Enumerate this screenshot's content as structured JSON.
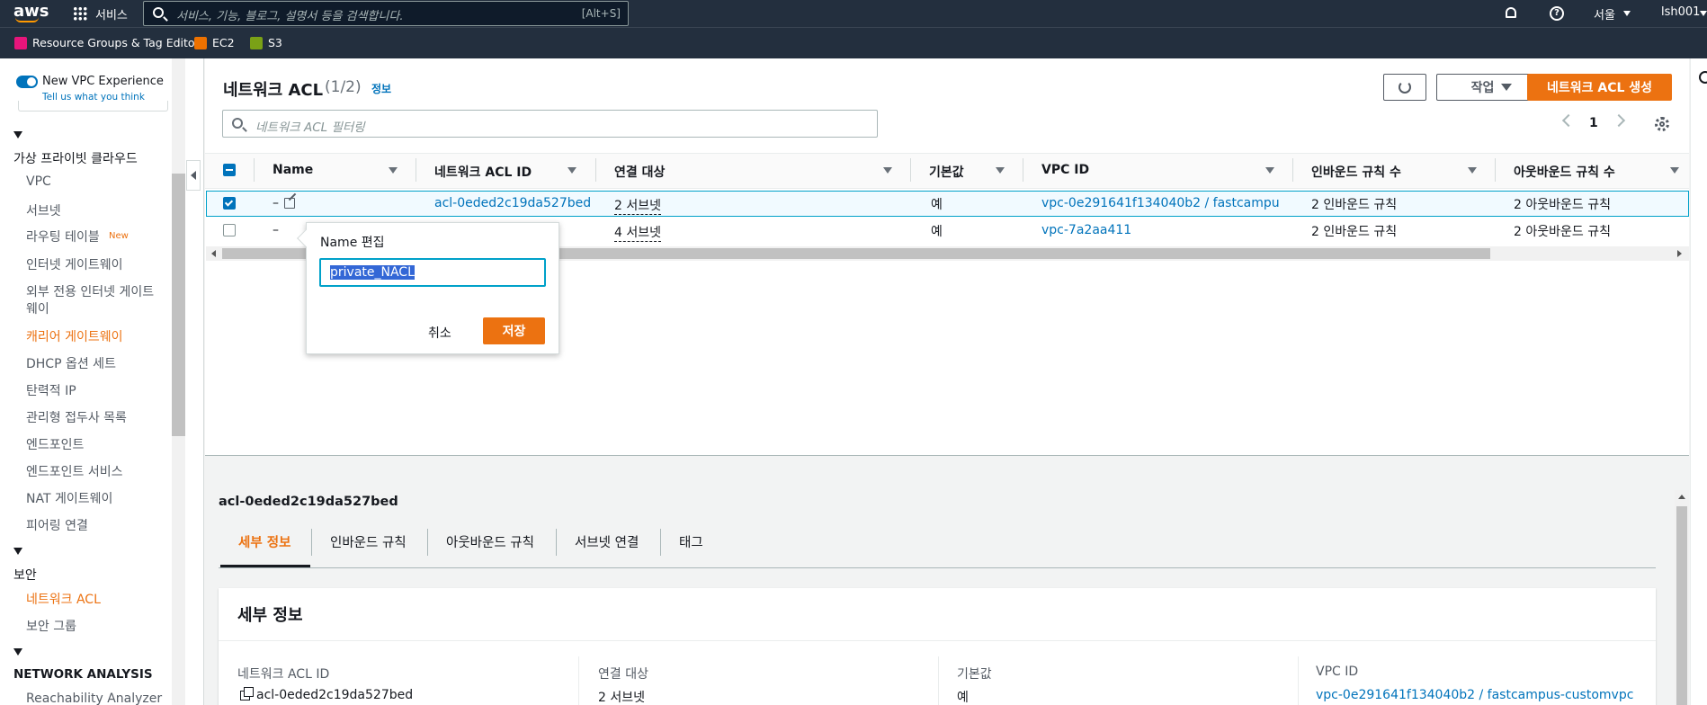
{
  "topnav": {
    "logo": "aws",
    "services_label": "서비스",
    "search_placeholder": "서비스, 기능, 블로그, 설명서 등을 검색합니다.",
    "search_shortcut": "[Alt+S]",
    "region": "서울",
    "account": "lsh001"
  },
  "favorites": [
    {
      "label": "Resource Groups & Tag Editor",
      "color": "#e7157b"
    },
    {
      "label": "EC2",
      "color": "#ed7100"
    },
    {
      "label": "S3",
      "color": "#7aa116"
    }
  ],
  "sidebar": {
    "toggle_label": "New VPC Experience",
    "toggle_sub": "Tell us what you think",
    "section1": "가상 프라이빗 클라우드",
    "items": [
      "VPC",
      "서브넷",
      "라우팅 테이블",
      "인터넷 게이트웨이",
      "외부 전용 인터넷 게이트",
      "웨이",
      "캐리어 게이트웨이",
      "DHCP 옵션 세트",
      "탄력적 IP",
      "관리형 접두사 목록",
      "엔드포인트",
      "엔드포인트 서비스",
      "NAT 게이트웨이",
      "피어링 연결"
    ],
    "new_badge": "New",
    "section2": "보안",
    "security_items": [
      "네트워크 ACL",
      "보안 그룹"
    ],
    "section3": "NETWORK ANALYSIS",
    "analysis_items": [
      "Reachability Analyzer"
    ]
  },
  "header": {
    "title": "네트워크 ACL",
    "count": "(1/2)",
    "info": "정보",
    "actions_label": "작업",
    "create_label": "네트워크 ACL 생성",
    "filter_placeholder": "네트워크 ACL 필터링",
    "page": "1"
  },
  "table": {
    "columns": [
      "Name",
      "네트워크 ACL ID",
      "연결 대상",
      "기본값",
      "VPC ID",
      "인바운드 규칙 수",
      "아웃바운드 규칙 수"
    ],
    "rows": [
      {
        "name": "–",
        "acl_id": "acl-0eded2c19da527bed",
        "assoc": "2 서브넷",
        "default": "예",
        "vpc": "vpc-0e291641f134040b2 / fastcampu…",
        "inbound": "2 인바운드 규칙",
        "outbound": "2 아웃바운드 규칙",
        "selected": true
      },
      {
        "name": "–",
        "acl_id": "",
        "assoc": "4 서브넷",
        "default": "예",
        "vpc": "vpc-7a2aa411",
        "inbound": "2 인바운드 규칙",
        "outbound": "2 아웃바운드 규칙",
        "selected": false
      }
    ]
  },
  "popover": {
    "title": "Name 편집",
    "value": "private_NACL",
    "cancel": "취소",
    "save": "저장"
  },
  "details": {
    "resource_id": "acl-0eded2c19da527bed",
    "tabs": [
      "세부 정보",
      "인바운드 규칙",
      "아웃바운드 규칙",
      "서브넷 연결",
      "태그"
    ],
    "panel_title": "세부 정보",
    "fields": [
      {
        "label": "네트워크 ACL ID",
        "value": "acl-0eded2c19da527bed"
      },
      {
        "label": "연결 대상",
        "value": "2 서브넷"
      },
      {
        "label": "기본값",
        "value": "예"
      },
      {
        "label": "VPC ID",
        "value": "vpc-0e291641f134040b2 / fastcampus-customvpc"
      }
    ]
  },
  "colors": {
    "nav_bg": "#232f3e",
    "accent": "#ec7211",
    "link": "#0073bb",
    "selected_row": "#f1faff"
  }
}
